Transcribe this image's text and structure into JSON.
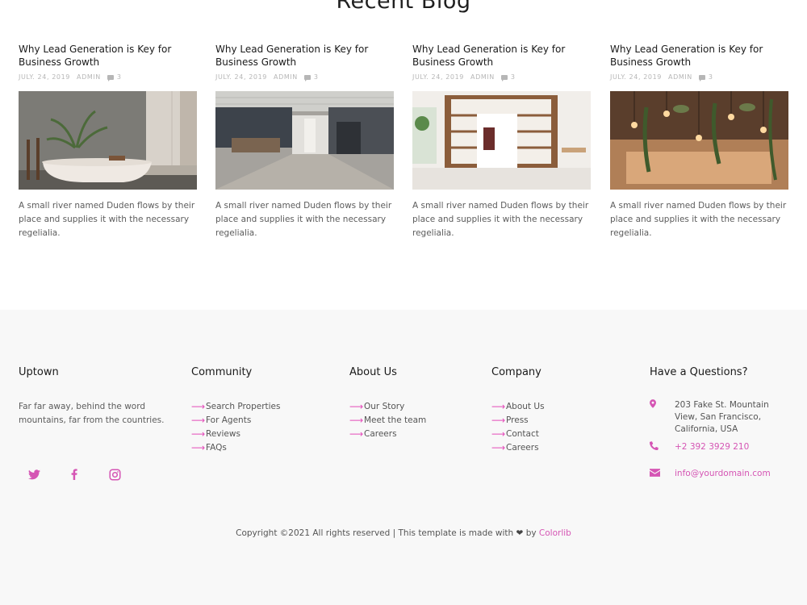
{
  "blog": {
    "title": "Recent Blog",
    "posts": [
      {
        "title": "Why Lead Generation is Key for Business Growth",
        "date": "JULY. 24, 2019",
        "author": "ADMIN",
        "comments": "3",
        "text": "A small river named Duden flows by their place and supplies it with the necessary regelialia.",
        "image_icon": "bathroom-photo"
      },
      {
        "title": "Why Lead Generation is Key for Business Growth",
        "date": "JULY. 24, 2019",
        "author": "ADMIN",
        "comments": "3",
        "text": "A small river named Duden flows by their place and supplies it with the necessary regelialia.",
        "image_icon": "office-hallway-photo"
      },
      {
        "title": "Why Lead Generation is Key for Business Growth",
        "date": "JULY. 24, 2019",
        "author": "ADMIN",
        "comments": "3",
        "text": "A small river named Duden flows by their place and supplies it with the necessary regelialia.",
        "image_icon": "shelving-room-photo"
      },
      {
        "title": "Why Lead Generation is Key for Business Growth",
        "date": "JULY. 24, 2019",
        "author": "ADMIN",
        "comments": "3",
        "text": "A small river named Duden flows by their place and supplies it with the necessary regelialia.",
        "image_icon": "hanging-plants-photo"
      }
    ]
  },
  "footer": {
    "brand": {
      "title": "Uptown",
      "text": "Far far away, behind the word mountains, far from the countries."
    },
    "social": [
      "twitter-icon",
      "facebook-icon",
      "instagram-icon"
    ],
    "community": {
      "title": "Community",
      "links": [
        "Search Properties",
        "For Agents",
        "Reviews",
        "FAQs"
      ]
    },
    "about": {
      "title": "About Us",
      "links": [
        "Our Story",
        "Meet the team",
        "Careers"
      ]
    },
    "company": {
      "title": "Company",
      "links": [
        "About Us",
        "Press",
        "Contact",
        "Careers"
      ]
    },
    "contact": {
      "title": "Have a Questions?",
      "address": "203 Fake St. Mountain View, San Francisco, California, USA",
      "phone": "+2 392 3929 210",
      "email": "info@yourdomain.com"
    },
    "copyright_prefix": "Copyright ©2021 All rights reserved | This template is made with",
    "copyright_by": "by",
    "copyright_brand": "Colorlib"
  },
  "colors": {
    "accent": "#d555b4",
    "footer_bg": "#f8f8f8",
    "text": "#5c5c5c"
  }
}
